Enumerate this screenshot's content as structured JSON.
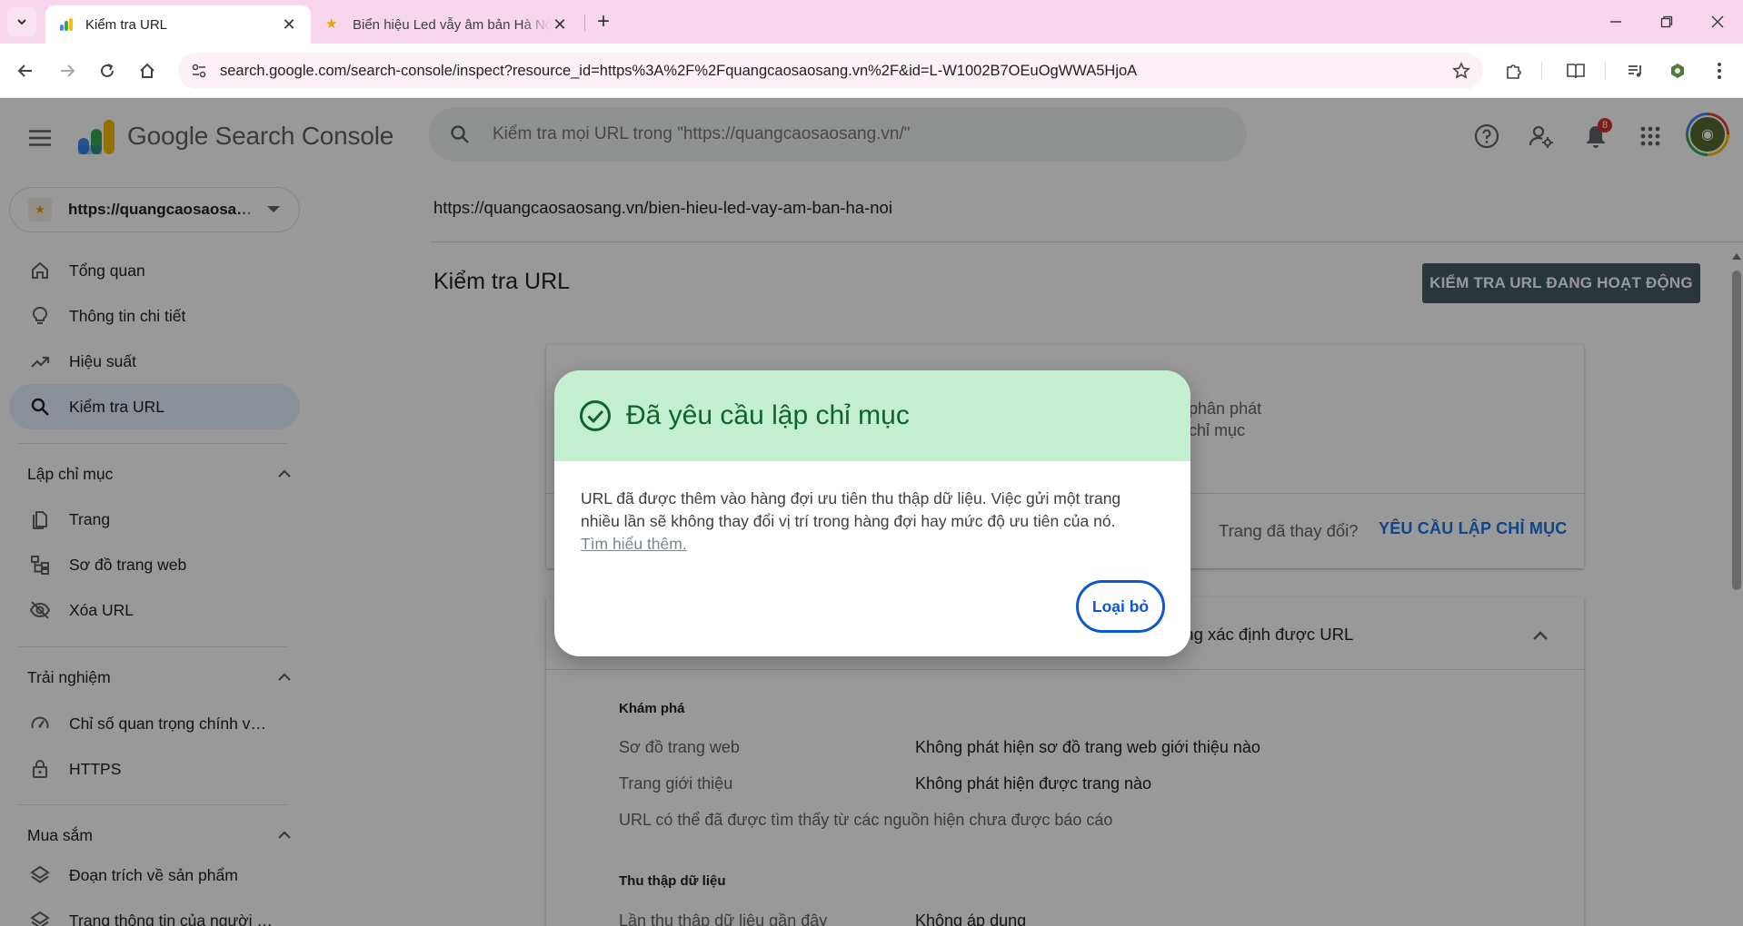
{
  "browser": {
    "tabs": [
      {
        "title": "Kiểm tra URL",
        "active": true
      },
      {
        "title": "Biển hiệu Led vẫy âm bản Hà Nội",
        "active": false
      }
    ],
    "address_bar": {
      "url": "search.google.com/search-console/inspect?resource_id=https%3A%2F%2Fquangcaosaosang.vn%2F&id=L-W1002B7OEuOgWWA5HjoA"
    }
  },
  "app": {
    "title": "Google Search Console",
    "search": {
      "placeholder": "Kiểm tra mọi URL trong \"https://quangcaosaosang.vn/\""
    },
    "notifications_count": "8",
    "property": {
      "label": "https://quangcaosaosang.vn/"
    },
    "nav": {
      "overview": "Tổng quan",
      "insights": "Thông tin chi tiết",
      "performance": "Hiệu suất",
      "url_inspection": "Kiểm tra URL",
      "indexing_section": "Lập chỉ mục",
      "pages": "Trang",
      "sitemaps": "Sơ đồ trang web",
      "removals": "Xóa URL",
      "experience_section": "Trải nghiệm",
      "core_web_vitals": "Chỉ số quan trọng chính về trang web",
      "https": "HTTPS",
      "shopping_section": "Mua sắm",
      "product_snippets": "Đoạn trích về sản phẩm",
      "merchant_listings": "Trang thông tin của người bán"
    }
  },
  "main": {
    "inspected_url": "https://quangcaosaosang.vn/bien-hieu-led-vay-am-ban-ha-noi",
    "heading": "Kiểm tra URL",
    "live_test_button": "KIỂM TRA URL ĐANG HOẠT ĐỘNG",
    "card1": {
      "partial_line_1": "g phân phát",
      "partial_line_2": "o chỉ mục",
      "changed_question": "Trang đã thay đổi?",
      "request_indexing": "YÊU CẦU LẬP CHỈ MỤC"
    },
    "card2": {
      "partial_header": "ong xác định được URL",
      "discovery_title": "Khám phá",
      "rows": [
        {
          "label": "Sơ đồ trang web",
          "value": "Không phát hiện sơ đồ trang web giới thiệu nào"
        },
        {
          "label": "Trang giới thiệu",
          "value": "Không phát hiện được trang nào"
        }
      ],
      "note": "URL có thể đã được tìm thấy từ các nguồn hiện chưa được báo cáo",
      "crawl_title": "Thu thập dữ liệu",
      "last_crawl_label": "Lần thu thập dữ liệu gần đây",
      "last_crawl_value": "Không áp dụng"
    }
  },
  "dialog": {
    "title": "Đã yêu cầu lập chỉ mục",
    "body": "URL đã được thêm vào hàng đợi ưu tiên thu thập dữ liệu. Việc gửi một trang nhiều lần sẽ không thay đổi vị trí trong hàng đợi hay mức độ ưu tiên của nó.",
    "learn_more": "Tìm hiểu thêm.",
    "dismiss_button": "Loại bỏ"
  },
  "colors": {
    "dialog_header_bg": "#c4eed0",
    "dialog_title": "#0d652d",
    "primary_blue": "#0b57d0",
    "live_test_button_bg": "#455a64",
    "tab_strip_bg": "#f8d7ec"
  }
}
